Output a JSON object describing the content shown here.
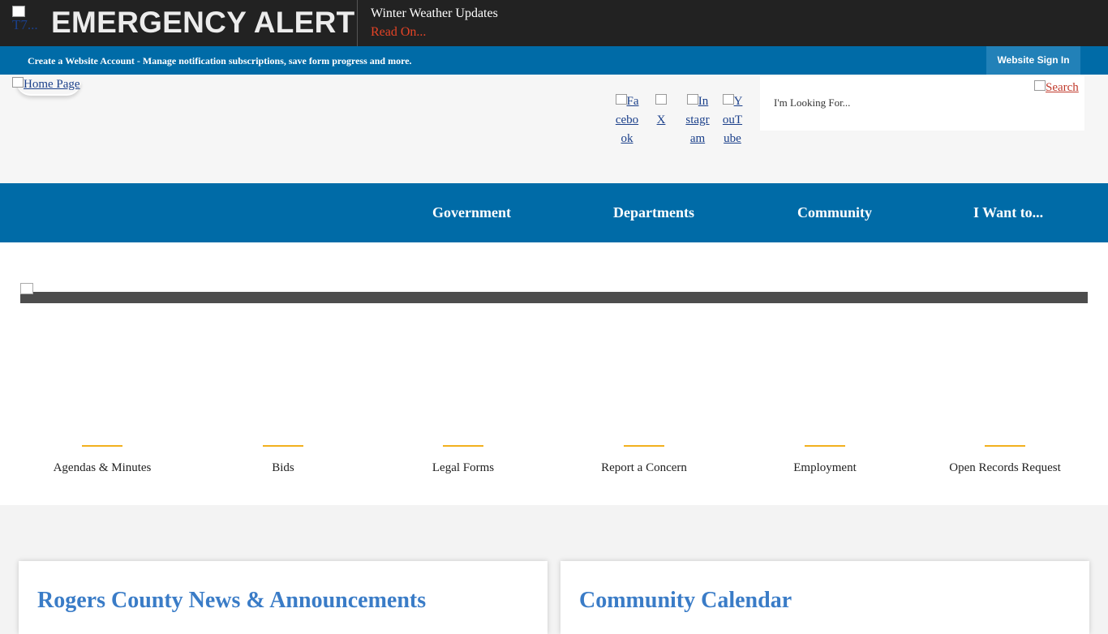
{
  "alert": {
    "icon_alt": "T7...",
    "title": "EMERGENCY ALERT",
    "headline": "Winter Weather Updates",
    "read_on": "Read On..."
  },
  "account_bar": {
    "text": "Create a Website Account - Manage notification subscriptions, save form progress and more.",
    "sign_in": "Website Sign In"
  },
  "header": {
    "home_link": "Home Page",
    "social": [
      {
        "label": "Facebook"
      },
      {
        "label": "X"
      },
      {
        "label": "Instagram"
      },
      {
        "label": "YouTube"
      }
    ],
    "search": {
      "placeholder": "I'm Looking For...",
      "button": "Search"
    }
  },
  "nav": {
    "items": [
      {
        "label": "Government"
      },
      {
        "label": "Departments"
      },
      {
        "label": "Community"
      },
      {
        "label": "I Want to..."
      }
    ]
  },
  "quick_links": [
    {
      "label": "Agendas & Minutes"
    },
    {
      "label": "Bids"
    },
    {
      "label": "Legal Forms"
    },
    {
      "label": "Report a Concern"
    },
    {
      "label": "Employment"
    },
    {
      "label": "Open Records Request"
    }
  ],
  "cards": [
    {
      "title": "Rogers County News & Announcements"
    },
    {
      "title": "Community Calendar"
    }
  ],
  "colors": {
    "alert_bg": "#222222",
    "brand_blue": "#006ba7",
    "accent_gold": "#f2b01e",
    "heading_blue": "#3a7cc7",
    "read_on_red": "#e44326"
  }
}
